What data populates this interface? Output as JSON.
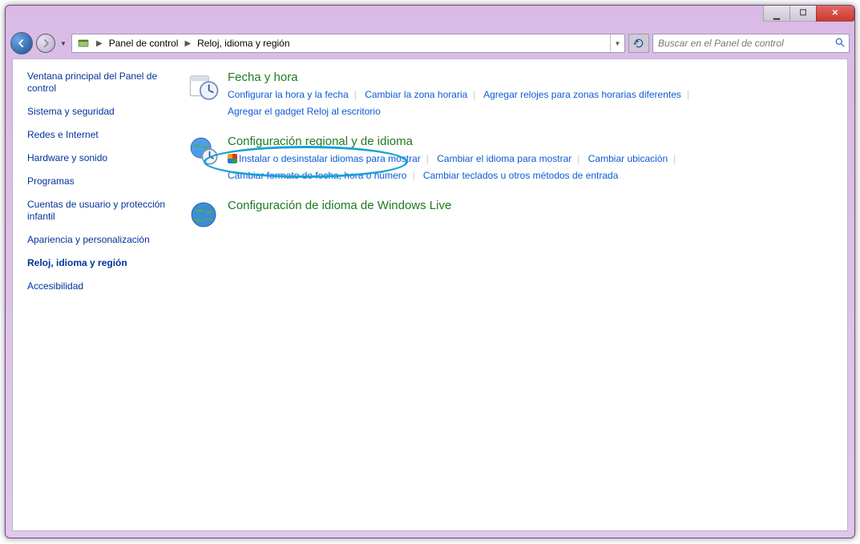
{
  "breadcrumb": {
    "root": "Panel de control",
    "leaf": "Reloj, idioma y región"
  },
  "search": {
    "placeholder": "Buscar en el Panel de control"
  },
  "sidebar": {
    "home": "Ventana principal del Panel de control",
    "items": [
      "Sistema y seguridad",
      "Redes e Internet",
      "Hardware y sonido",
      "Programas",
      "Cuentas de usuario y protección infantil",
      "Apariencia y personalización",
      "Reloj, idioma y región",
      "Accesibilidad"
    ],
    "current_index": 6
  },
  "categories": [
    {
      "title": "Fecha y hora",
      "icon": "clock-calendar",
      "links": [
        {
          "text": "Configurar la hora y la fecha"
        },
        {
          "text": "Cambiar la zona horaria"
        },
        {
          "text": "Agregar relojes para zonas horarias diferentes"
        },
        {
          "text": "Agregar el gadget Reloj al escritorio"
        }
      ]
    },
    {
      "title": "Configuración regional y de idioma",
      "icon": "globe-clock",
      "links": [
        {
          "text": "Instalar o desinstalar idiomas para mostrar",
          "shield": true
        },
        {
          "text": "Cambiar el idioma para mostrar"
        },
        {
          "text": "Cambiar ubicación"
        },
        {
          "text": "Cambiar formato de fecha, hora o número"
        },
        {
          "text": "Cambiar teclados u otros métodos de entrada"
        }
      ]
    },
    {
      "title": "Configuración de idioma de Windows Live",
      "icon": "globe",
      "links": []
    }
  ]
}
